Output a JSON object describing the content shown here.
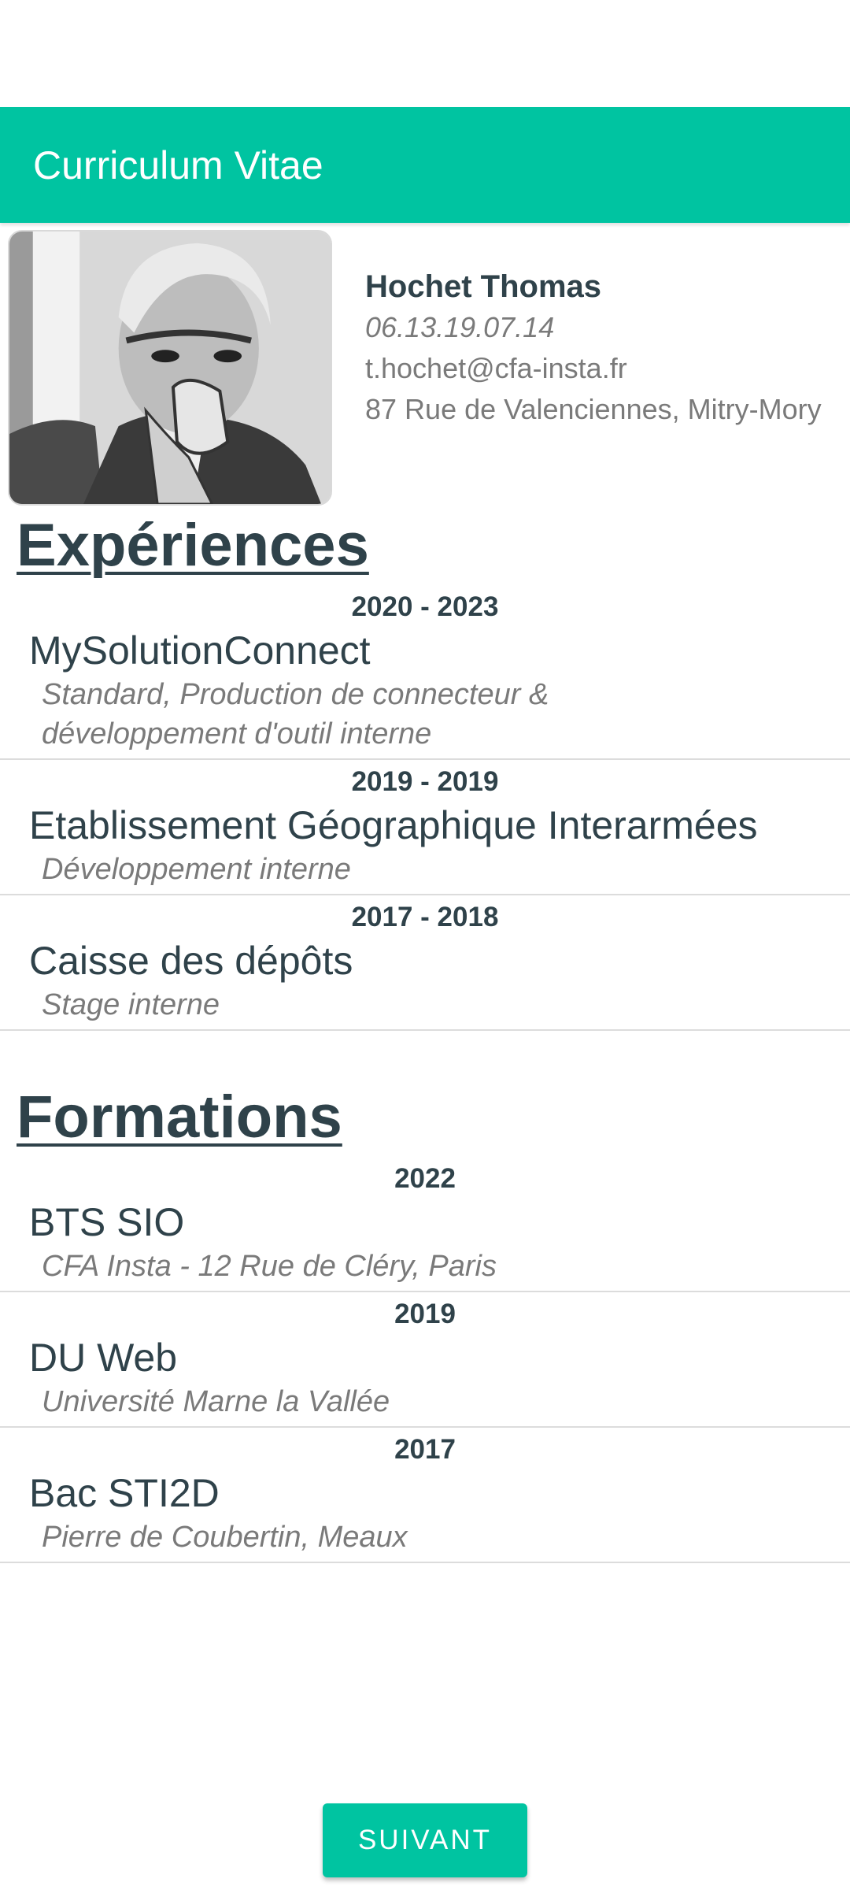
{
  "app_bar": {
    "title": "Curriculum Vitae"
  },
  "profile": {
    "name": "Hochet Thomas",
    "phone": "06.13.19.07.14",
    "email": "t.hochet@cfa-insta.fr",
    "address": "87 Rue de Valenciennes, Mitry-Mory"
  },
  "experiences": {
    "title": "Expériences",
    "items": [
      {
        "date": "2020 - 2023",
        "org": "MySolutionConnect",
        "desc": "Standard, Production de connecteur & développement d'outil interne"
      },
      {
        "date": "2019 - 2019",
        "org": "Etablissement Géographique Interarmées",
        "desc": "Développement interne"
      },
      {
        "date": "2017 - 2018",
        "org": "Caisse des dépôts",
        "desc": "Stage interne"
      }
    ]
  },
  "formations": {
    "title": "Formations",
    "items": [
      {
        "date": "2022",
        "org": "BTS SIO",
        "desc": "CFA Insta - 12 Rue de Cléry, Paris"
      },
      {
        "date": "2019",
        "org": "DU Web",
        "desc": "Université Marne la Vallée"
      },
      {
        "date": "2017",
        "org": "Bac STI2D",
        "desc": "Pierre de Coubertin, Meaux"
      }
    ]
  },
  "next_button": {
    "label": "SUIVANT"
  },
  "colors": {
    "accent": "#00c4a1",
    "heading": "#2f424a",
    "muted": "#7a7a7a"
  }
}
